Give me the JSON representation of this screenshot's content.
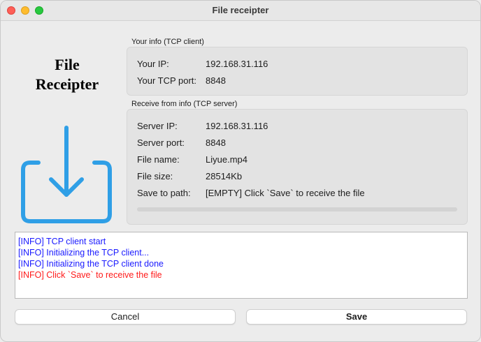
{
  "window": {
    "title": "File receipter"
  },
  "app_title": {
    "line1": "File",
    "line2": "Receipter"
  },
  "your_info": {
    "group_label": "Your info (TCP client)",
    "ip_label": "Your IP:",
    "ip_value": "192.168.31.116",
    "port_label": "Your TCP port:",
    "port_value": "8848"
  },
  "server_info": {
    "group_label": "Receive from info (TCP server)",
    "ip_label": "Server IP:",
    "ip_value": "192.168.31.116",
    "port_label": "Server port:",
    "port_value": "8848",
    "file_name_label": "File name:",
    "file_name_value": "Liyue.mp4",
    "file_size_label": "File size:",
    "file_size_value": "28514Kb",
    "save_path_label": "Save to path:",
    "save_path_value": "[EMPTY] Click `Save` to receive the file",
    "progress_percent": 0
  },
  "log": [
    {
      "text": "[INFO] TCP client start",
      "color": "#1a1aff"
    },
    {
      "text": "[INFO] Initializing the TCP client...",
      "color": "#1a1aff"
    },
    {
      "text": "[INFO] Initializing the TCP client done",
      "color": "#1a1aff"
    },
    {
      "text": "[INFO] Click `Save` to receive the file",
      "color": "#ff1a1a"
    }
  ],
  "buttons": {
    "cancel_label": "Cancel",
    "save_label": "Save"
  },
  "colors": {
    "icon_blue": "#2f9fe6"
  }
}
